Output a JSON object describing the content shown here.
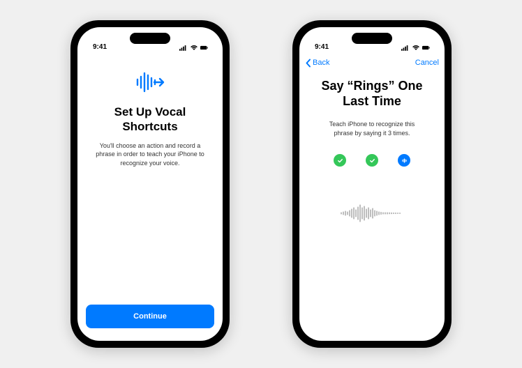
{
  "status": {
    "time": "9:41"
  },
  "screen1": {
    "title": "Set Up Vocal Shortcuts",
    "subtitle": "You'll choose an action and record a phrase in order to teach your iPhone to recognize your voice.",
    "continue_label": "Continue"
  },
  "screen2": {
    "back_label": "Back",
    "cancel_label": "Cancel",
    "title": "Say “Rings” One Last Time",
    "subtitle": "Teach iPhone to recognize this phrase by saying it 3 times.",
    "progress": [
      {
        "state": "done"
      },
      {
        "state": "done"
      },
      {
        "state": "active"
      }
    ]
  }
}
